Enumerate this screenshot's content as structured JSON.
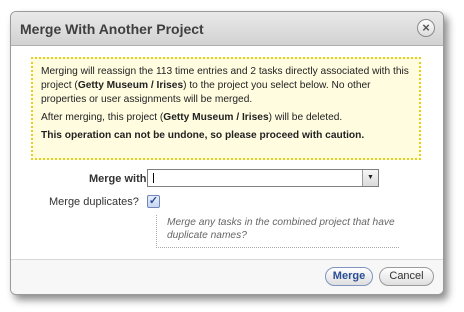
{
  "dialog": {
    "title": "Merge With Another Project",
    "close_glyph": "×"
  },
  "warning": {
    "line1_a": "Merging will reassign the 113 time entries and 2 tasks directly associated with this project (",
    "project_name": "Getty Museum / Irises",
    "line1_b": ") to the project you select below. No other properties or user assignments will be merged.",
    "line2_a": "After merging, this project (",
    "line2_b": ") will be deleted.",
    "line3": "This operation can not be undone, so please proceed with caution."
  },
  "form": {
    "merge_with_label": "Merge with:",
    "merge_with_value": "",
    "merge_duplicates_label": "Merge duplicates?",
    "merge_duplicates_checked": true,
    "hint": "Merge any tasks in the combined project that have duplicate names?"
  },
  "buttons": {
    "merge": "Merge",
    "cancel": "Cancel"
  },
  "icons": {
    "close": "close-icon",
    "dropdown": "chevron-down-icon",
    "check": "check-icon"
  },
  "colors": {
    "warning_bg": "#fffce0",
    "warning_border": "#e3d11a",
    "accent": "#2a4d94"
  }
}
